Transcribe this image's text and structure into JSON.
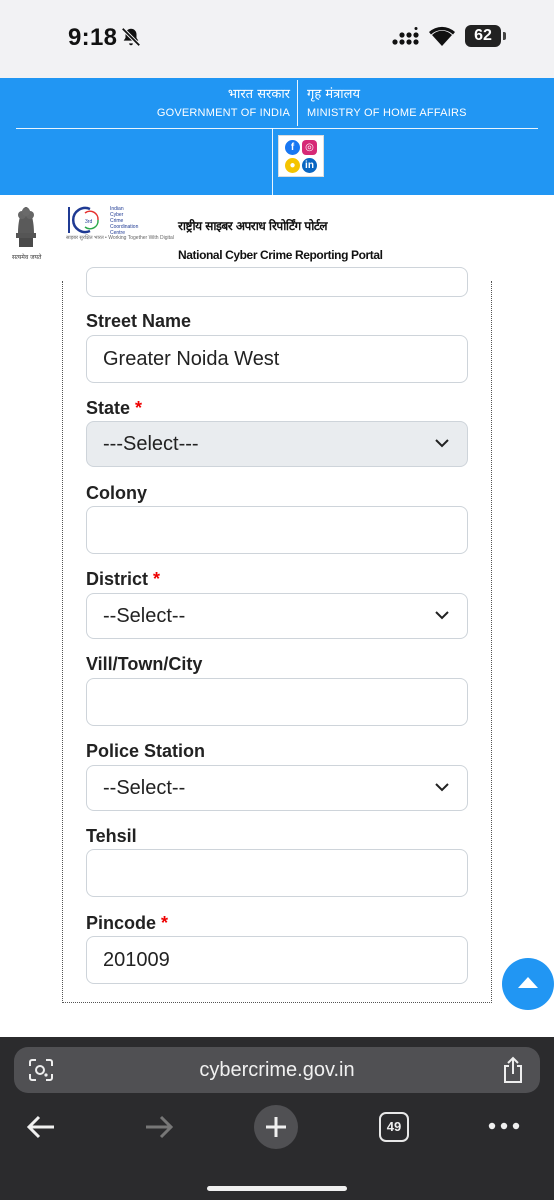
{
  "status_bar": {
    "time": "9:18",
    "battery": "62"
  },
  "gov_header": {
    "left_hindi": "भारत सरकार",
    "left_english": "GOVERNMENT OF INDIA",
    "right_hindi": "गृह मंत्रालय",
    "right_english": "MINISTRY OF HOME AFFAIRS"
  },
  "portal_header": {
    "title_hindi": "राष्ट्रीय साइबर अपराध रिपोर्टिंग पोर्टल",
    "title_english": "National Cyber Crime Reporting Portal",
    "emblem_caption": "सत्यमेव जयते",
    "i4c_lines": [
      "Indian",
      "Cyber",
      "Crime",
      "Coordination",
      "Centre"
    ],
    "i4c_tagline": "साइबर सुरक्षित भारत • Working Together With Digital",
    "i4c_anniversary": "3rd"
  },
  "form": {
    "street_name": {
      "label": "Street Name",
      "value": "Greater Noida West"
    },
    "state": {
      "label": "State",
      "required": "*",
      "value": "---Select---"
    },
    "colony": {
      "label": "Colony",
      "value": ""
    },
    "district": {
      "label": "District",
      "required": "*",
      "value": "--Select--"
    },
    "vill_town_city": {
      "label": "Vill/Town/City",
      "value": ""
    },
    "police_station": {
      "label": "Police Station",
      "value": "--Select--"
    },
    "tehsil": {
      "label": "Tehsil",
      "value": ""
    },
    "pincode": {
      "label": "Pincode",
      "required": "*",
      "value": "201009"
    }
  },
  "browser": {
    "url": "cybercrime.gov.in",
    "tab_count": "49"
  },
  "colors": {
    "header_blue": "#2196f3",
    "required_red": "#e00000",
    "browser_dark": "#2b2b2d"
  }
}
